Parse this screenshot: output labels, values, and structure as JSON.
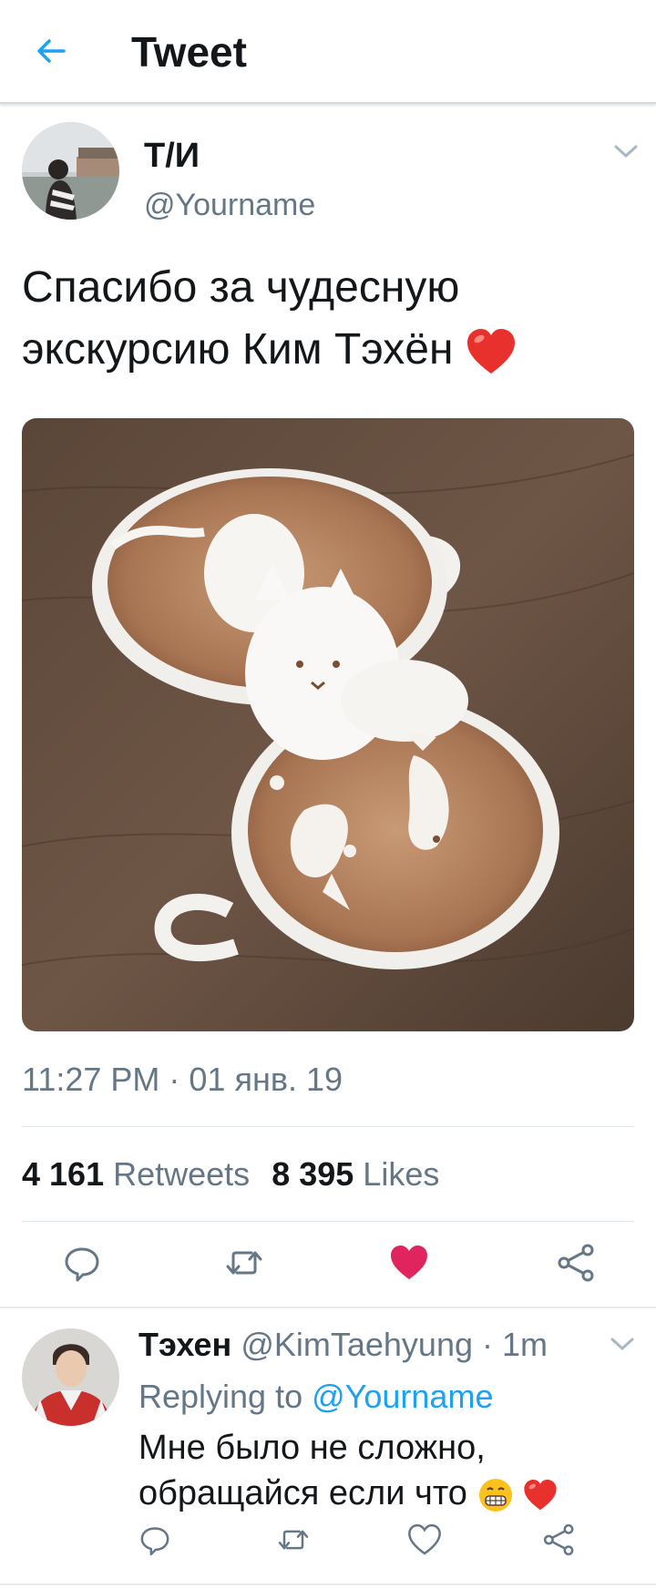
{
  "header": {
    "title": "Tweet",
    "back_icon": "arrow-left-icon"
  },
  "tweet": {
    "author_name": "Т/И",
    "author_handle": "@Yourname",
    "text": "Спасибо за чудесную экскурсию Ким Тэхён",
    "text_emoji": "heart-emoji",
    "timestamp": "11:27 PM · 01 янв. 19",
    "retweets_count": "4 161",
    "retweets_label": "Retweets",
    "likes_count": "8 395",
    "likes_label": "Likes",
    "liked": true,
    "media_icon": "latte-art-photo"
  },
  "actions": [
    "reply-icon",
    "retweet-icon",
    "like-icon",
    "share-icon"
  ],
  "reply": {
    "author_name": "Тэхен",
    "author_handle": "@KimTaehyung",
    "time_sep": "·",
    "time": "1m",
    "replying_to_label": "Replying to",
    "replying_to_handle": "@Yourname",
    "text_line1": "Мне было не сложно,",
    "text_line2": "обращайся если что"
  },
  "colors": {
    "accent": "#1da1f2",
    "like": "#e0245e",
    "secondary_text": "#657786"
  }
}
